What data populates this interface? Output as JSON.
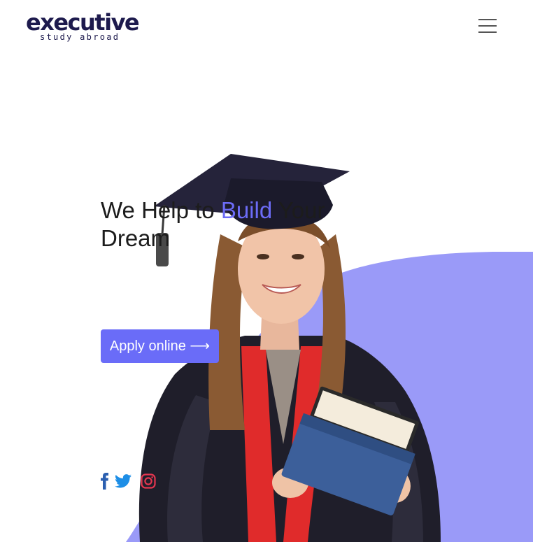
{
  "brand": {
    "name": "executive",
    "tagline": "study abroad",
    "color": "#1d1a4d"
  },
  "header": {
    "menu_icon": "hamburger-icon"
  },
  "hero": {
    "title_part1": "We Help to ",
    "title_accent": "Build",
    "title_part2": " Your Dream",
    "accent_color": "#6c6cf6",
    "cta_label": "Apply online ⟶",
    "cta_color": "#6a6cf8",
    "background_shape_color": "#9a9af8",
    "image": "graduate-student-photo"
  },
  "social": {
    "icons": [
      "facebook-icon",
      "twitter-icon",
      "instagram-icon"
    ]
  }
}
